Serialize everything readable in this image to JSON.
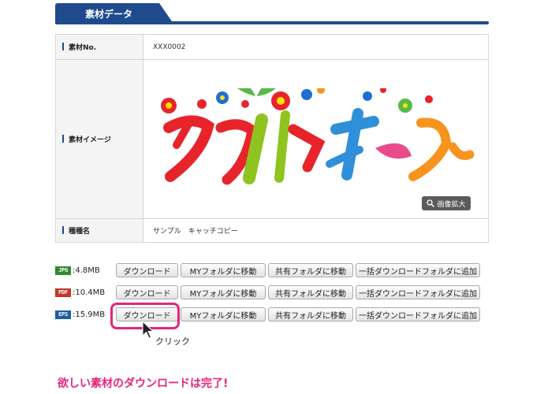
{
  "section": {
    "title": "素材データ"
  },
  "info": {
    "no_label": "素材No.",
    "no_value": "XXX0002",
    "image_label": "素材イメージ",
    "zoom_label": "画像拡大",
    "type_label": "種種名",
    "type_value": "サンプル　キャッチコピー"
  },
  "downloads": [
    {
      "format": "JPG",
      "color": "#2e8b2e",
      "size": ":4.8MB"
    },
    {
      "format": "PDF",
      "color": "#c0392b",
      "size": ":10.4MB"
    },
    {
      "format": "EPS",
      "color": "#1f5fa0",
      "size": ":15.9MB"
    }
  ],
  "buttons": {
    "download": "ダウンロード",
    "my_folder": "MYフォルダに移動",
    "shared_folder": "共有フォルダに移動",
    "bulk_add": "一括ダウンロードフォルダに追加"
  },
  "annotation": {
    "click": "クリック",
    "done": "欲しい素材のダウンロードは完了!"
  },
  "colors": {
    "accent": "#e6247b",
    "header": "#1f4b8e"
  }
}
